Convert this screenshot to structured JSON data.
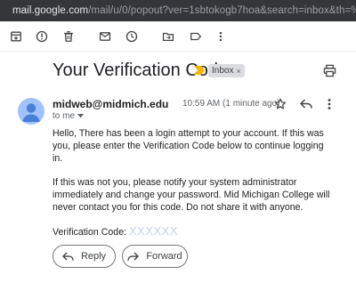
{
  "browser": {
    "url_host": "mail.google.com",
    "url_path": "/mail/u/0/popout?ver=1sbtokogb7hoa&search=inbox&th=%23thr..."
  },
  "toolbar": {
    "icons": [
      "archive-icon",
      "report-spam-icon",
      "delete-icon",
      "mark-unread-icon",
      "snooze-icon",
      "move-to-icon",
      "label-icon",
      "more-vert-icon"
    ]
  },
  "email": {
    "subject": "Your Verification Code",
    "label": "Inbox",
    "label_remove": "×",
    "sender": "midweb@midmich.edu",
    "recipient": "to me",
    "time": "10:59 AM (1 minute ago)",
    "body": {
      "p1": "Hello, There has been a login attempt to your account. If this was you, please enter the Verification Code below to continue logging in.",
      "p2": "If this was not you, please notify your system administrator immediately and change your password. Mid Michigan College will never contact you for this code. Do not share it with anyone.",
      "code_label": "Verification Code:",
      "code_value": "XXXXXX"
    }
  },
  "actions": {
    "reply": "Reply",
    "forward": "Forward"
  },
  "colors": {
    "important_marker": "#f4b400",
    "avatar": "#a0c3ff",
    "masked_code": "#c7d2e8"
  }
}
